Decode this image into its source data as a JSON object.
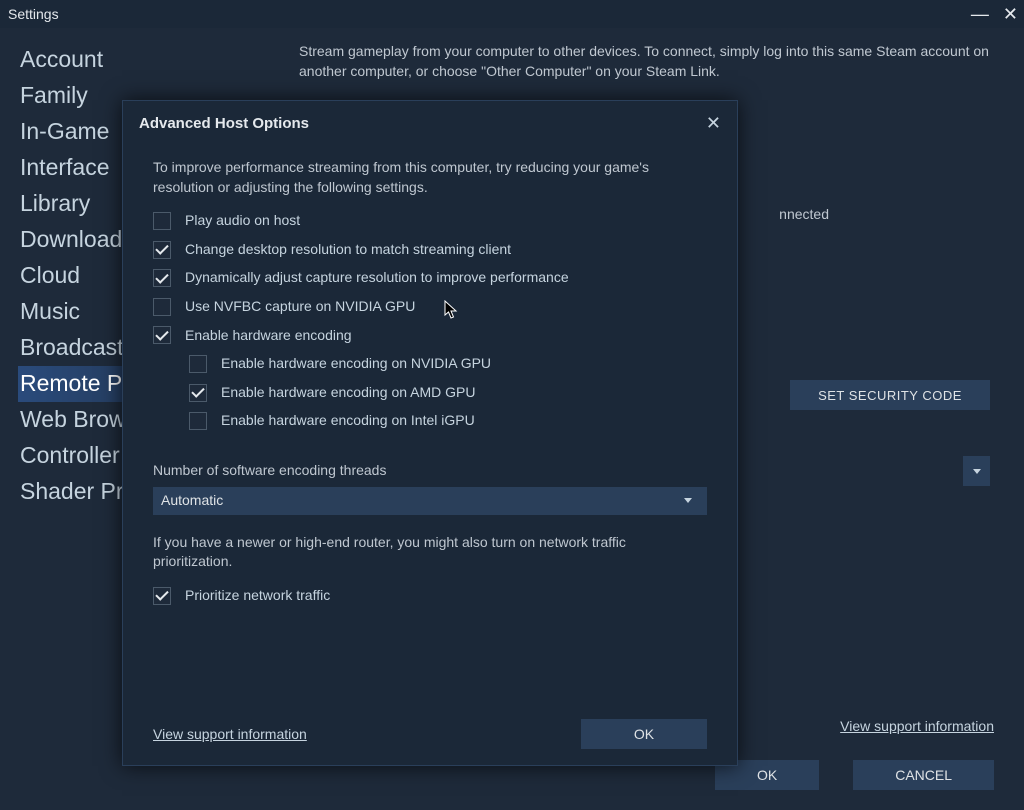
{
  "window": {
    "title": "Settings",
    "minimize": "—",
    "close": "✕"
  },
  "sidebar": {
    "items": [
      {
        "label": "Account"
      },
      {
        "label": "Family"
      },
      {
        "label": "In-Game"
      },
      {
        "label": "Interface"
      },
      {
        "label": "Library"
      },
      {
        "label": "Downloads"
      },
      {
        "label": "Cloud"
      },
      {
        "label": "Music"
      },
      {
        "label": "Broadcasting"
      },
      {
        "label": "Remote Play",
        "selected": true
      },
      {
        "label": "Web Browser"
      },
      {
        "label": "Controller"
      },
      {
        "label": "Shader Pre-Caching"
      }
    ]
  },
  "main": {
    "description": "Stream gameplay from your computer to other devices. To connect, simply log into this same Steam account on another computer, or choose \"Other Computer\" on your Steam Link.",
    "connected_label": "nnected",
    "set_security_label": "SET SECURITY CODE",
    "support_link": "View support information",
    "ok_label": "OK",
    "cancel_label": "CANCEL"
  },
  "dialog": {
    "title": "Advanced Host Options",
    "intro": "To improve performance streaming from this computer, try reducing your game's resolution or adjusting the following settings.",
    "checks": [
      {
        "label": "Play audio on host",
        "checked": false
      },
      {
        "label": "Change desktop resolution to match streaming client",
        "checked": true
      },
      {
        "label": "Dynamically adjust capture resolution to improve performance",
        "checked": true
      },
      {
        "label": "Use NVFBC capture on NVIDIA GPU",
        "checked": false
      },
      {
        "label": "Enable hardware encoding",
        "checked": true
      }
    ],
    "sub_checks": [
      {
        "label": "Enable hardware encoding on NVIDIA GPU",
        "checked": false
      },
      {
        "label": "Enable hardware encoding on AMD GPU",
        "checked": true
      },
      {
        "label": "Enable hardware encoding on Intel iGPU",
        "checked": false
      }
    ],
    "threads_label": "Number of software encoding threads",
    "threads_value": "Automatic",
    "router_note": "If you have a newer or high-end router, you might also turn on network traffic prioritization.",
    "prioritize": {
      "label": "Prioritize network traffic",
      "checked": true
    },
    "support_link": "View support information",
    "ok_label": "OK"
  }
}
